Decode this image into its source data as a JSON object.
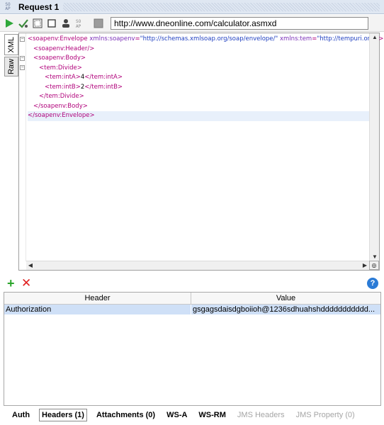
{
  "window": {
    "logo_text": [
      "SO",
      "AP"
    ],
    "title": "Request 1"
  },
  "toolbar": {
    "url": "http://www.dneonline.com/calculator.asmxd",
    "icons": [
      "run-icon",
      "validate-icon",
      "format-icon",
      "stop-icon",
      "user-icon",
      "soap-icon",
      "cancel-square-icon"
    ]
  },
  "editor": {
    "tabs": [
      "XML",
      "Raw"
    ],
    "lines": [
      {
        "indent": 0,
        "parts": [
          {
            "c": "tag",
            "t": "<soapenv:Envelope "
          },
          {
            "c": "attr",
            "t": "xmlns:soapenv"
          },
          {
            "c": "tag",
            "t": "="
          },
          {
            "c": "val",
            "t": "\"http://schemas.xmlsoap.org/soap/envelope/\""
          },
          {
            "c": "attr",
            "t": " xmlns:tem"
          },
          {
            "c": "tag",
            "t": "="
          },
          {
            "c": "val",
            "t": "\"http://tempuri.org/\""
          },
          {
            "c": "tag",
            "t": ">"
          }
        ]
      },
      {
        "indent": 1,
        "parts": [
          {
            "c": "tag",
            "t": "<soapenv:Header/>"
          }
        ]
      },
      {
        "indent": 1,
        "parts": [
          {
            "c": "tag",
            "t": "<soapenv:Body>"
          }
        ]
      },
      {
        "indent": 2,
        "parts": [
          {
            "c": "tag",
            "t": "<tem:Divide>"
          }
        ]
      },
      {
        "indent": 3,
        "parts": [
          {
            "c": "tag",
            "t": "<tem:intA>"
          },
          {
            "c": "txt",
            "t": "4"
          },
          {
            "c": "tag",
            "t": "</tem:intA>"
          }
        ]
      },
      {
        "indent": 3,
        "parts": [
          {
            "c": "tag",
            "t": "<tem:intB>"
          },
          {
            "c": "txt",
            "t": "2"
          },
          {
            "c": "tag",
            "t": "</tem:intB>"
          }
        ]
      },
      {
        "indent": 2,
        "parts": [
          {
            "c": "tag",
            "t": "</tem:Divide>"
          }
        ]
      },
      {
        "indent": 1,
        "parts": [
          {
            "c": "tag",
            "t": "</soapenv:Body>"
          }
        ]
      },
      {
        "indent": 0,
        "parts": [
          {
            "c": "tag",
            "t": "</soapenv:Envelope>"
          }
        ],
        "highlight": true
      }
    ]
  },
  "headers_table": {
    "columns": [
      "Header",
      "Value"
    ],
    "rows": [
      {
        "header": "Authorization",
        "value": "gsgagsdaisdgboiioh@1236sdhuahshddddddddddd..."
      }
    ]
  },
  "bottom_tabs": [
    {
      "label": "Auth",
      "state": "normal"
    },
    {
      "label": "Headers (1)",
      "state": "active"
    },
    {
      "label": "Attachments (0)",
      "state": "normal"
    },
    {
      "label": "WS-A",
      "state": "normal"
    },
    {
      "label": "WS-RM",
      "state": "normal"
    },
    {
      "label": "JMS Headers",
      "state": "disabled"
    },
    {
      "label": "JMS Property (0)",
      "state": "disabled"
    }
  ],
  "colors": {
    "tag": "#b0007a",
    "attribute": "#7a2eb8",
    "value": "#1f3fc0",
    "selected_row": "#cfe0f7",
    "add": "#2aa52a",
    "remove": "#e02020",
    "help": "#2b7bd6"
  }
}
